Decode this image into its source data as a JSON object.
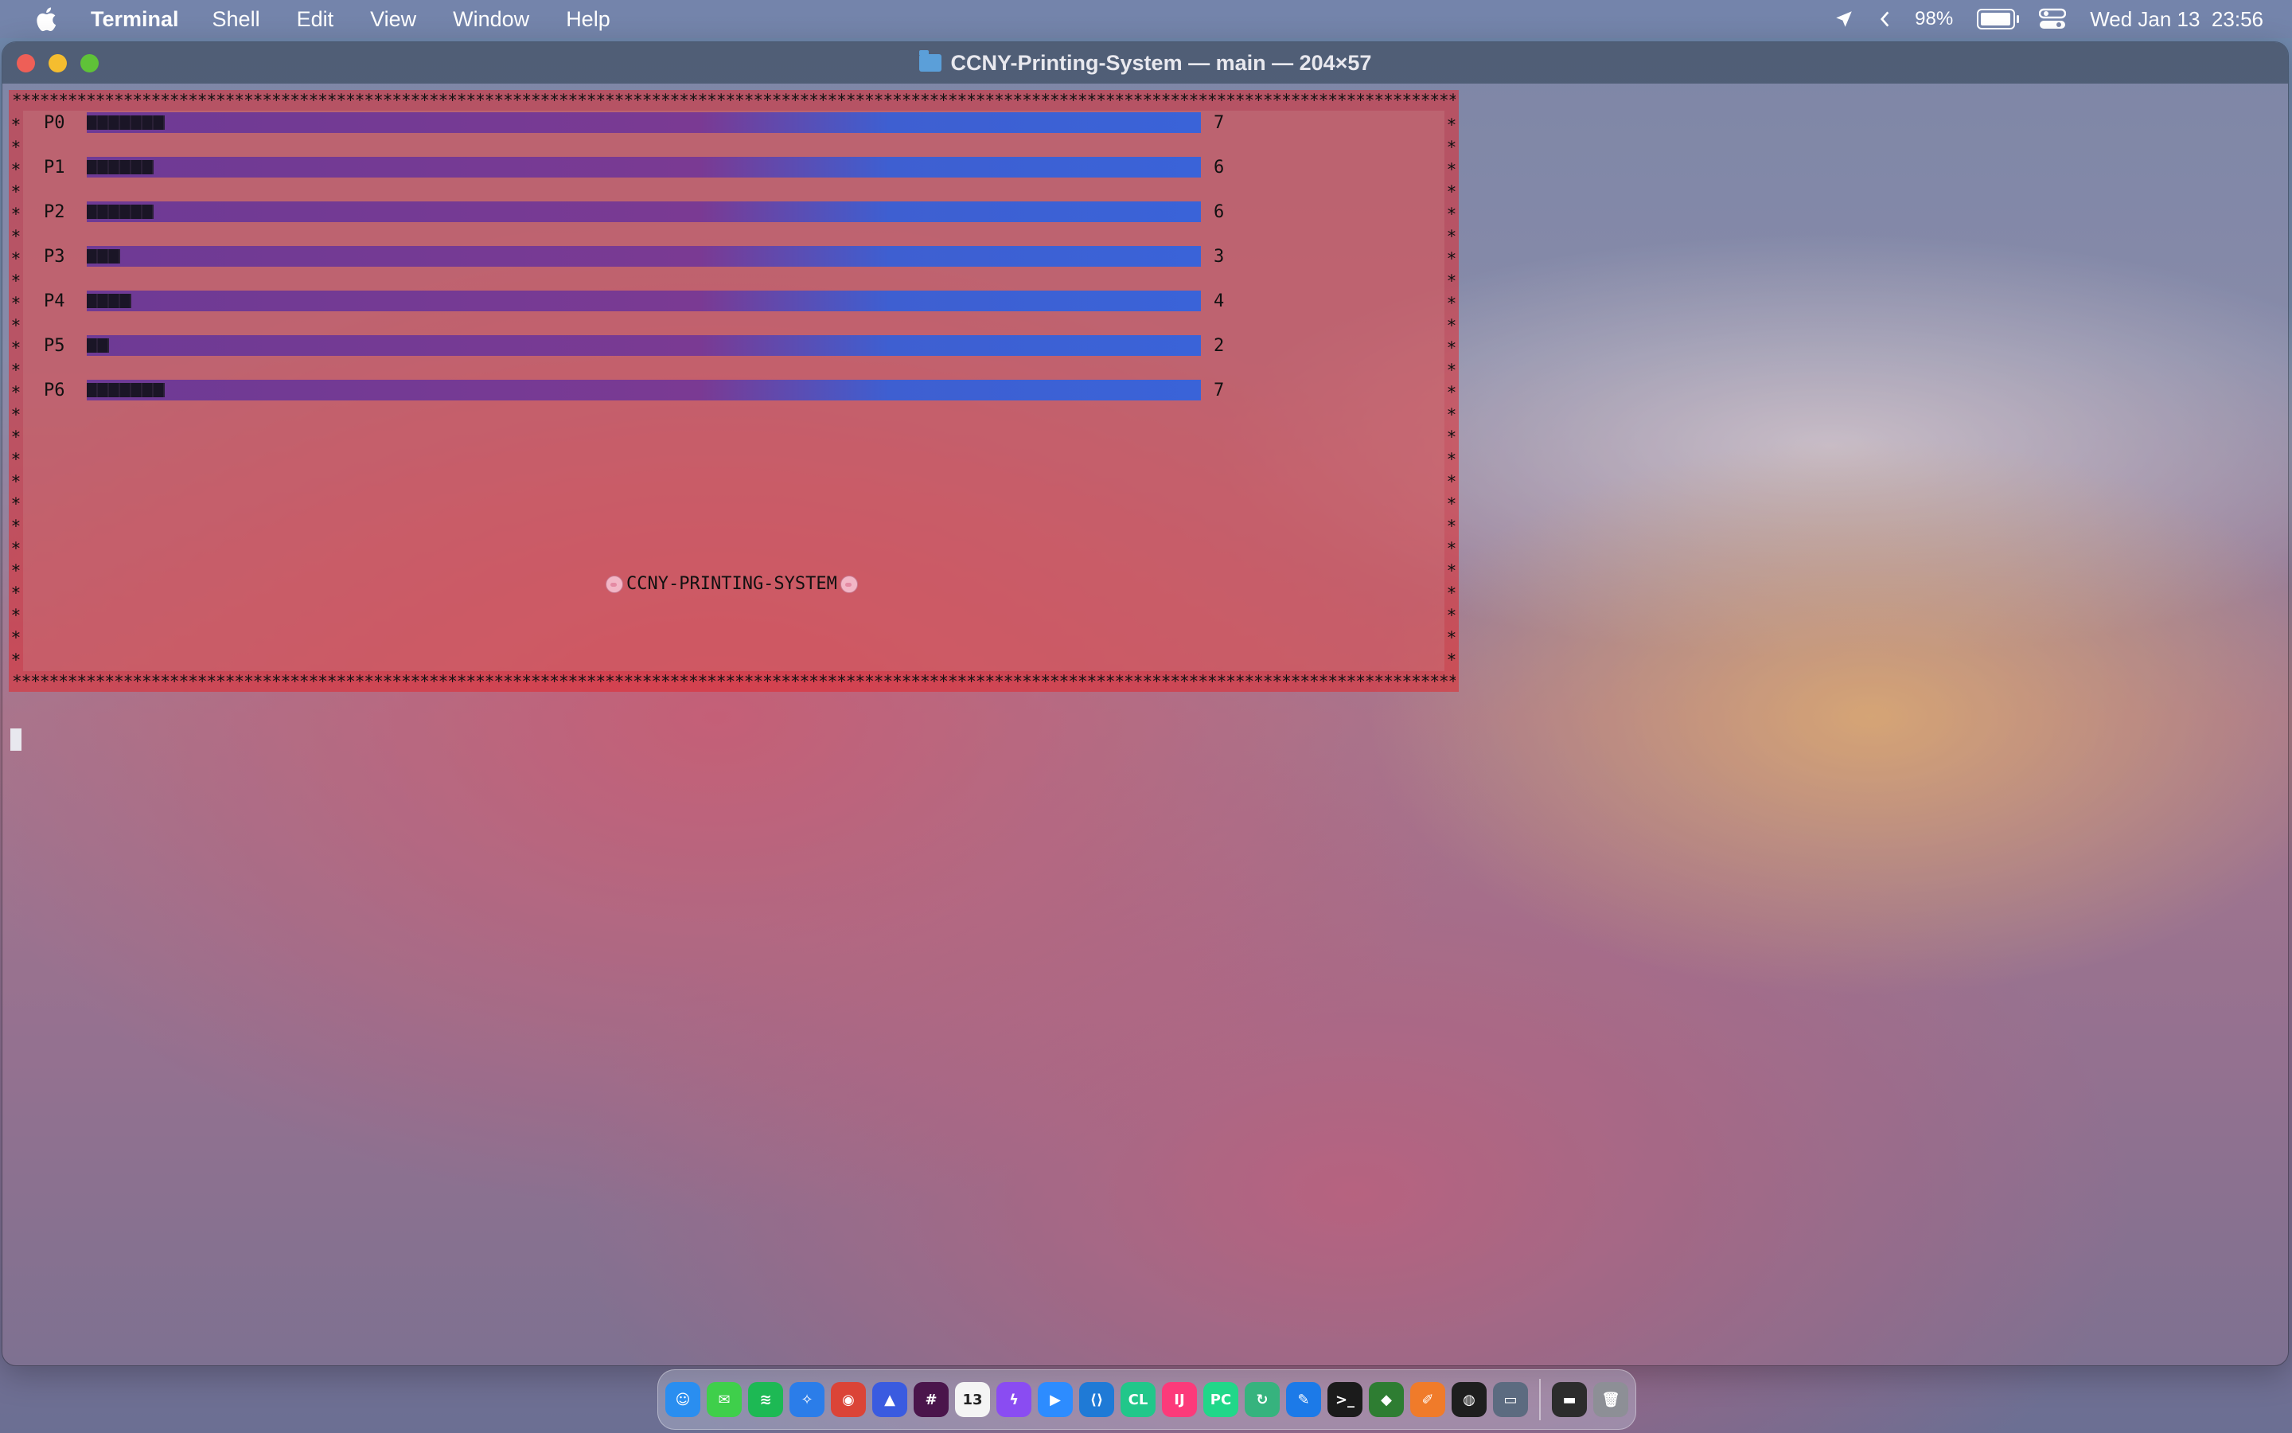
{
  "menubar": {
    "app_name": "Terminal",
    "menus": [
      "Shell",
      "Edit",
      "View",
      "Window",
      "Help"
    ],
    "battery_percent": "98%",
    "battery_level": 0.98,
    "datetime": "Wed Jan 13  23:56"
  },
  "window": {
    "title": "CCNY-Printing-System — main — 204×57"
  },
  "terminal": {
    "bars": [
      {
        "label": "P0",
        "value": "7",
        "fraction": 0.07
      },
      {
        "label": "P1",
        "value": "6",
        "fraction": 0.06
      },
      {
        "label": "P2",
        "value": "6",
        "fraction": 0.06
      },
      {
        "label": "P3",
        "value": "3",
        "fraction": 0.03
      },
      {
        "label": "P4",
        "value": "4",
        "fraction": 0.04
      },
      {
        "label": "P5",
        "value": "2",
        "fraction": 0.02
      },
      {
        "label": "P6",
        "value": "7",
        "fraction": 0.07
      }
    ],
    "banner": "CCNY-PRINTING-SYSTEM",
    "border_char": "*"
  },
  "dock": {
    "apps": [
      {
        "name": "finder-icon",
        "glyph": "☺",
        "color": "#2a8ef0"
      },
      {
        "name": "messages-icon",
        "glyph": "✉",
        "color": "#3fcf4b"
      },
      {
        "name": "spotify-icon",
        "glyph": "≋",
        "color": "#1db954"
      },
      {
        "name": "safari-icon",
        "glyph": "✧",
        "color": "#2b7de9"
      },
      {
        "name": "chrome-icon",
        "glyph": "◉",
        "color": "#db4437"
      },
      {
        "name": "arc-icon",
        "glyph": "▲",
        "color": "#3a5be0"
      },
      {
        "name": "slack-icon",
        "glyph": "#",
        "color": "#4a154b"
      },
      {
        "name": "calendar-icon",
        "glyph": "13",
        "color": "#f4f4f4"
      },
      {
        "name": "messenger-icon",
        "glyph": "ϟ",
        "color": "#8a4cf2"
      },
      {
        "name": "zoom-icon",
        "glyph": "▶",
        "color": "#2d8cff"
      },
      {
        "name": "vscode-icon",
        "glyph": "⟨⟩",
        "color": "#1f7ad6"
      },
      {
        "name": "clion-icon",
        "glyph": "CL",
        "color": "#21c78a"
      },
      {
        "name": "intellij-icon",
        "glyph": "IJ",
        "color": "#fc3a7a"
      },
      {
        "name": "pycharm-icon",
        "glyph": "PC",
        "color": "#21d789"
      },
      {
        "name": "refresh-app-icon",
        "glyph": "↻",
        "color": "#36b37e"
      },
      {
        "name": "xcode-icon",
        "glyph": "✎",
        "color": "#1c7ae8"
      },
      {
        "name": "terminal-icon",
        "glyph": ">_",
        "color": "#1b1b1b"
      },
      {
        "name": "sourcetree-icon",
        "glyph": "◆",
        "color": "#2e7d32"
      },
      {
        "name": "pages-icon",
        "glyph": "✐",
        "color": "#f07b2a"
      },
      {
        "name": "figma-icon",
        "glyph": "◍",
        "color": "#1e1e1e"
      },
      {
        "name": "preview-icon",
        "glyph": "▭",
        "color": "#5c6b80"
      },
      {
        "name": "terminal-window-icon",
        "glyph": "▬",
        "color": "#2c2c2c"
      },
      {
        "name": "trash-icon",
        "glyph": "🗑",
        "color": "#8d8f96"
      }
    ]
  }
}
